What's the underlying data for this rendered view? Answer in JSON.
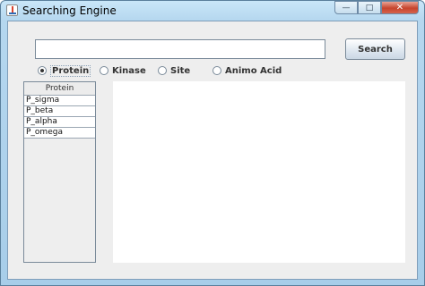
{
  "window": {
    "title": "Searching Engine",
    "icon": "java-app-icon",
    "controls": {
      "minimize": "—",
      "maximize": "□",
      "close": "✕"
    }
  },
  "search": {
    "value": "",
    "button_label": "Search"
  },
  "radios": [
    {
      "label": "Protein",
      "checked": true
    },
    {
      "label": "Kinase",
      "checked": false
    },
    {
      "label": "Site",
      "checked": false
    },
    {
      "label": "Animo Acid",
      "checked": false
    }
  ],
  "table": {
    "header": "Protein",
    "rows": [
      "P_sigma",
      "P_beta",
      "P_alpha",
      "P_omega"
    ]
  },
  "results": {
    "text": ""
  },
  "colors": {
    "title_gradient": "#b5d7ef",
    "client_bg": "#eeeeee",
    "close_button": "#c7442d"
  }
}
